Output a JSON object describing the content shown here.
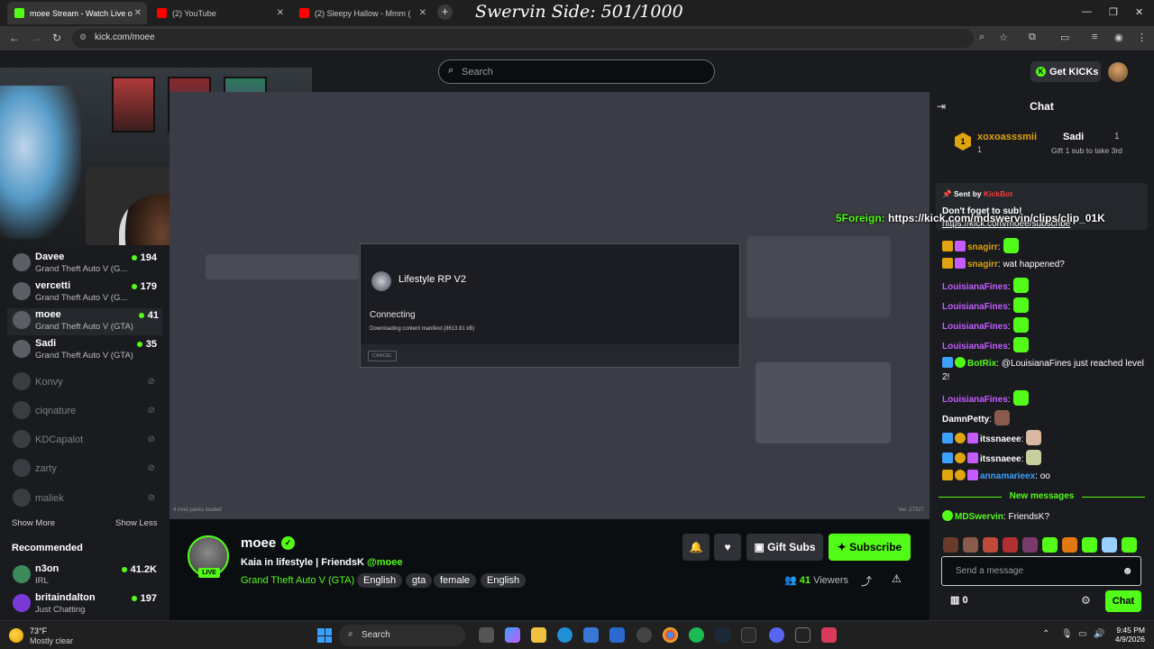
{
  "browser": {
    "tabs": [
      {
        "label": "moee Stream - Watch Live o",
        "active": true,
        "icon_color": "#53fc18"
      },
      {
        "label": "(2) YouTube",
        "active": false,
        "icon_color": "#ff0000"
      },
      {
        "label": "(2) Sleepy Hallow - Mmm (",
        "active": false,
        "icon_color": "#ff0000"
      }
    ],
    "overlay_text": "Swervin Side: 501/1000",
    "url": "kick.com/moee"
  },
  "header": {
    "search_placeholder": "Search",
    "get_kicks_label": "Get KICKs",
    "k_letter": "K"
  },
  "sidebar": {
    "following": [
      {
        "name": "Davee",
        "game": "Grand Theft Auto V (G...",
        "viewers": "194",
        "live": true
      },
      {
        "name": "vercetti",
        "game": "Grand Theft Auto V (G...",
        "viewers": "179",
        "live": true
      },
      {
        "name": "moee",
        "game": "Grand Theft Auto V (GTA)",
        "viewers": "41",
        "live": true,
        "active": true
      },
      {
        "name": "Sadi",
        "game": "Grand Theft Auto V (GTA)",
        "viewers": "35",
        "live": true
      },
      {
        "name": "Konvy",
        "live": false
      },
      {
        "name": "ciqnature",
        "live": false
      },
      {
        "name": "KDCapalot",
        "live": false
      },
      {
        "name": "zarty",
        "live": false
      },
      {
        "name": "maliek",
        "live": false
      }
    ],
    "show_more": "Show More",
    "show_less": "Show Less",
    "recommended_heading": "Recommended",
    "recommended": [
      {
        "name": "n3on",
        "game": "IRL",
        "viewers": "41.2K"
      },
      {
        "name": "britaindalton",
        "game": "Just Chatting",
        "viewers": "197"
      }
    ]
  },
  "player": {
    "dialog_title": "Lifestyle RP V2",
    "status": "Connecting",
    "substatus": "Downloading content manifest (8613.81 kB)",
    "cancel_label": "CANCEL",
    "footer_left": "4 mod packs loaded",
    "footer_right": "Ver. 27927"
  },
  "stream": {
    "channel": "moee",
    "live_label": "LIVE",
    "title": "Kaia in lifestyle | FriendsK",
    "title_mention": "@moee",
    "category": "Grand Theft Auto V (GTA)",
    "tags": [
      "English",
      "gta",
      "female",
      "English"
    ],
    "gift_subs_label": "Gift Subs",
    "subscribe_label": "Subscribe",
    "viewers_count": "41",
    "viewers_label": "Viewers"
  },
  "chat": {
    "title": "Chat",
    "leaderboard": {
      "left_name": "xoxoasssmii",
      "left_rank": "1",
      "left_count": "1",
      "right_name": "Sadi",
      "right_count": "1",
      "right_sub": "Gift 1 sub to take 3rd"
    },
    "pinned": {
      "sent_by": "Sent by",
      "bot": "KickBot",
      "message": "Don't foget to sub!",
      "link": "https://kick.com/moee/subscribe"
    },
    "overlay_user": "5Foreign:",
    "overlay_link": "https://kick.com/mdswervin/clips/clip_01K",
    "messages": [
      {
        "user": "snagirr",
        "text": ":",
        "color": "#e0a40f",
        "emote": true
      },
      {
        "user": "snagirr",
        "text": ": wat happened?",
        "color": "#e0a40f"
      },
      {
        "user": "LouisianaFines",
        "text": ":",
        "color": "#c45cff",
        "emote": true
      },
      {
        "user": "LouisianaFines",
        "text": ":",
        "color": "#c45cff",
        "emote": true
      },
      {
        "user": "LouisianaFines",
        "text": ":",
        "color": "#c45cff",
        "emote": true
      },
      {
        "user": "LouisianaFines",
        "text": ":",
        "color": "#c45cff",
        "emote": true
      },
      {
        "user": "BotRix",
        "text": ": @LouisianaFines just reached level 2!",
        "color": "#53fc18"
      },
      {
        "user": "LouisianaFines",
        "text": ":",
        "color": "#c45cff",
        "emote": true
      },
      {
        "user": "DamnPetty",
        "text": ":",
        "color": "#ffffff",
        "emote": true
      },
      {
        "user": "itssnaeee",
        "text": ":",
        "color": "#ffffff",
        "emote": true
      },
      {
        "user": "itssnaeee",
        "text": ":",
        "color": "#ffffff",
        "emote": true
      },
      {
        "user": "annamarieex",
        "text": ": oo",
        "color": "#3ba1ff"
      }
    ],
    "new_messages_label": "New messages",
    "last_message": {
      "user": "MDSwervin",
      "text": ": FriendsK?",
      "color": "#53fc18"
    },
    "input_placeholder": "Send a message",
    "points": "0",
    "send_label": "Chat"
  },
  "taskbar": {
    "temperature": "73°F",
    "weather": "Mostly clear",
    "search_label": "Search",
    "time": "9:45 PM",
    "date": "4/9/2026"
  }
}
